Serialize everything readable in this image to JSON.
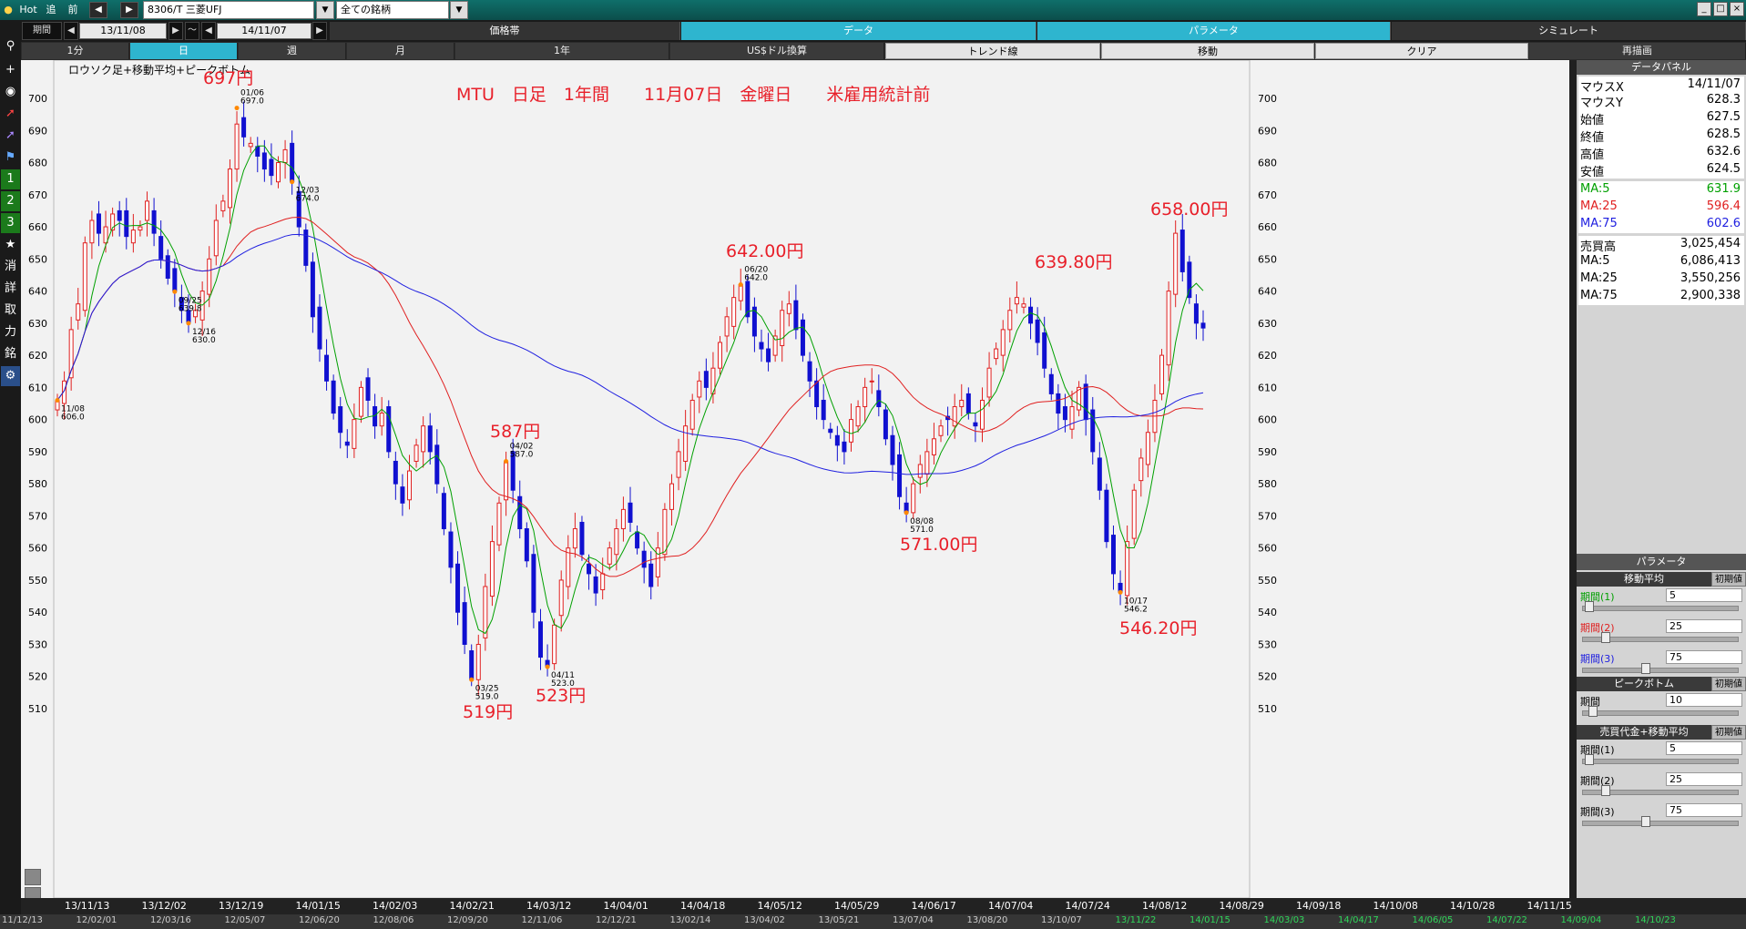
{
  "topbar": {
    "hot": "Hot",
    "tsui": "追",
    "mae": "前",
    "symbol": "8306/T 三菱UFJ",
    "category": "全ての銘柄",
    "tabs": [
      "価格帯",
      "データ",
      "パラメータ",
      "シミュレート"
    ],
    "window_buttons": [
      "_",
      "□",
      "×"
    ]
  },
  "row2": {
    "period_label": "期間",
    "from": "13/11/08",
    "sep": "～",
    "to": "14/11/07",
    "tabs": [
      "価格帯",
      "データ",
      "パラメータ",
      "シミュレート"
    ]
  },
  "row3": {
    "tabs": [
      "1分",
      "日",
      "週",
      "月",
      "1年",
      "US$ドル換算",
      "トレンド線",
      "移動",
      "クリア",
      "再描画"
    ]
  },
  "lefttb": {
    "icons": [
      "lightbulb-icon",
      "search-icon",
      "crosshair-icon",
      "camera-icon",
      "chart-line-icon",
      "chart-line2-icon",
      "flag-icon",
      "num1-icon",
      "num2-icon",
      "num3-icon",
      "star-icon"
    ],
    "digits": [
      "1",
      "2",
      "3"
    ],
    "kanji": [
      "消",
      "詳",
      "取",
      "力",
      "銘"
    ]
  },
  "chart": {
    "subtitle": "ロウソク足+移動平均+ピークボトム",
    "headline": "MTU　日足　1年間　　11月07日　金曜日　　米雇用統計前",
    "y_ticks": [
      510,
      520,
      530,
      540,
      550,
      560,
      570,
      580,
      590,
      600,
      610,
      620,
      630,
      640,
      650,
      660,
      670,
      680,
      690,
      700
    ],
    "x_ticks": [
      "13/11/13",
      "13/12/02",
      "13/12/19",
      "14/01/15",
      "14/02/03",
      "14/02/21",
      "14/03/12",
      "14/04/01",
      "14/04/18",
      "14/05/12",
      "14/05/29",
      "14/06/17",
      "14/07/04",
      "14/07/24",
      "14/08/12",
      "14/08/29",
      "14/09/18",
      "14/10/08",
      "14/10/28",
      "14/11/15"
    ],
    "bottom_strip": [
      "11/12/13",
      "12/02/01",
      "12/03/16",
      "12/05/07",
      "12/06/20",
      "12/08/06",
      "12/09/20",
      "12/11/06",
      "12/12/21",
      "13/02/14",
      "13/04/02",
      "13/05/21",
      "13/07/04",
      "13/08/20",
      "13/10/07",
      "13/11/22",
      "14/01/15",
      "14/03/03",
      "14/04/17",
      "14/06/05",
      "14/07/22",
      "14/09/04",
      "14/10/23"
    ],
    "peak_labels": [
      {
        "date": "11/08",
        "value": "606.0"
      },
      {
        "date": "12/03",
        "value": "674.0"
      },
      {
        "date": "12/16",
        "value": "630.0"
      },
      {
        "date": "01/06",
        "value": "697.0"
      },
      {
        "date": "03/25",
        "value": "519.0"
      },
      {
        "date": "04/02",
        "value": "587.0"
      },
      {
        "date": "04/11",
        "value": "523.0"
      },
      {
        "date": "06/20",
        "value": "642.0"
      },
      {
        "date": "08/08",
        "value": "571.0"
      },
      {
        "date": "09/25",
        "value": "639.8"
      },
      {
        "date": "10/17",
        "value": "546.2"
      }
    ],
    "annotations": [
      "697円",
      "587円",
      "519円",
      "523円",
      "642.00円",
      "571.00円",
      "639.80円",
      "658.00円",
      "546.20円"
    ],
    "colors": {
      "ma5": "#00a000",
      "ma25": "#e02020",
      "ma75": "#2020e0",
      "up": "#e02020",
      "down": "#1010d0",
      "annot": "#e8202a"
    }
  },
  "chart_data": {
    "type": "candlestick",
    "ylim": [
      505,
      712
    ],
    "series": [
      {
        "name": "MA:5"
      },
      {
        "name": "MA:25"
      },
      {
        "name": "MA:75"
      }
    ],
    "closes": [
      606,
      612,
      628,
      636,
      655,
      662,
      658,
      660,
      664,
      662,
      657,
      659,
      660,
      668,
      658,
      650,
      644,
      640,
      634,
      630,
      634,
      640,
      650,
      662,
      668,
      678,
      692,
      688,
      686,
      682,
      678,
      676,
      680,
      684,
      674,
      660,
      648,
      632,
      622,
      612,
      602,
      596,
      592,
      600,
      610,
      606,
      598,
      602,
      590,
      580,
      574,
      584,
      592,
      598,
      590,
      580,
      566,
      554,
      540,
      530,
      519,
      530,
      548,
      562,
      574,
      587,
      578,
      566,
      556,
      540,
      526,
      523,
      536,
      550,
      560,
      566,
      558,
      552,
      546,
      552,
      560,
      566,
      572,
      568,
      560,
      554,
      548,
      560,
      572,
      580,
      590,
      598,
      606,
      612,
      610,
      616,
      624,
      632,
      638,
      642,
      632,
      626,
      622,
      618,
      626,
      634,
      636,
      628,
      620,
      612,
      604,
      600,
      596,
      592,
      590,
      600,
      604,
      610,
      612,
      604,
      594,
      586,
      576,
      571,
      580,
      586,
      590,
      594,
      598,
      600,
      604,
      606,
      602,
      598,
      606,
      616,
      622,
      628,
      634,
      638,
      636,
      630,
      624,
      616,
      608,
      602,
      600,
      604,
      610,
      600,
      590,
      578,
      562,
      552,
      546.2,
      562,
      578,
      588,
      596,
      606,
      620,
      640,
      658,
      646,
      638,
      630,
      628.5
    ]
  },
  "panel": {
    "head": "データパネル",
    "rows": [
      {
        "l": "マウスX",
        "v": "14/11/07"
      },
      {
        "l": "マウスY",
        "v": "628.3"
      },
      {
        "l": "始値",
        "v": "627.5"
      },
      {
        "l": "終値",
        "v": "628.5"
      },
      {
        "l": "高値",
        "v": "632.6"
      },
      {
        "l": "安値",
        "v": "624.5"
      },
      {
        "l": "MA:5",
        "v": "631.9"
      },
      {
        "l": "MA:25",
        "v": "596.4"
      },
      {
        "l": "MA:75",
        "v": "602.6"
      },
      {
        "l": "売買高",
        "v": "3,025,454"
      },
      {
        "l": "MA:5",
        "v": "6,086,413"
      },
      {
        "l": "MA:25",
        "v": "3,550,256"
      },
      {
        "l": "MA:75",
        "v": "2,900,338"
      }
    ],
    "param_head": "パラメータ",
    "ma_head": "移動平均",
    "init": "初期値",
    "ma_rows": [
      {
        "l": "期間(1)",
        "v": "5"
      },
      {
        "l": "期間(2)",
        "v": "25"
      },
      {
        "l": "期間(3)",
        "v": "75"
      }
    ],
    "pb_head": "ピークボトム",
    "pb_rows": [
      {
        "l": "期間",
        "v": "10"
      }
    ],
    "vol_head": "売買代金+移動平均",
    "vol_rows": [
      {
        "l": "期間(1)",
        "v": "5"
      },
      {
        "l": "期間(2)",
        "v": "25"
      },
      {
        "l": "期間(3)",
        "v": "75"
      }
    ]
  }
}
